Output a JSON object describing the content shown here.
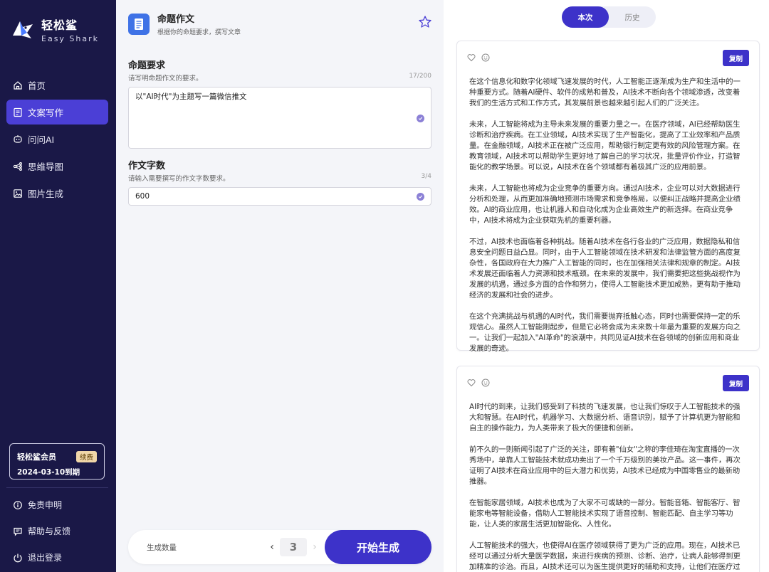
{
  "brand": {
    "name_cn": "轻松鲨",
    "name_en": "Easy Shark"
  },
  "nav": {
    "items": [
      {
        "label": "首页",
        "icon": "home-icon"
      },
      {
        "label": "文案写作",
        "icon": "document-icon",
        "active": true
      },
      {
        "label": "问问AI",
        "icon": "chat-ai-icon"
      },
      {
        "label": "思维导图",
        "icon": "mindmap-icon"
      },
      {
        "label": "图片生成",
        "icon": "image-icon"
      }
    ]
  },
  "member": {
    "title": "轻松鲨会员",
    "renew_label": "续费",
    "expiry": "2024-03-10到期"
  },
  "bottom_nav": {
    "disclaimer": "免责申明",
    "help": "帮助与反馈",
    "logout": "退出登录"
  },
  "tool": {
    "title": "命题作文",
    "subtitle": "根据你的命题要求，撰写文章"
  },
  "requirement": {
    "label": "命题要求",
    "desc": "请写明命题作文的要求。",
    "count": "17/200",
    "value": "以\"AI时代\"为主题写一篇微信推文"
  },
  "wordcount": {
    "label": "作文字数",
    "desc": "请输入需要撰写的作文字数要求。",
    "count": "3/4",
    "value": "600"
  },
  "generate": {
    "count_label": "生成数量",
    "count_value": "3",
    "button_label": "开始生成"
  },
  "result_tabs": {
    "current": "本次",
    "history": "历史"
  },
  "results": [
    {
      "copy_label": "复制",
      "paragraphs": [
        "在这个信息化和数字化领域飞速发展的时代，人工智能正逐渐成为生产和生活中的一种重要方式。随着AI硬件、软件的成熟和普及，AI技术不断向各个领域渗透，改变着我们的生活方式和工作方式，其发展前景也越来越引起人们的广泛关注。",
        "未来，人工智能将成为主导未来发展的重要力量之一。在医疗领域，AI已经帮助医生诊断和治疗疾病。在工业领域，AI技术实现了生产智能化，提高了工业效率和产品质量。在金融领域，AI技术正在被广泛应用，帮助银行制定更有效的风险管理方案。在教育领域，AI技术可以帮助学生更好地了解自己的学习状况，批量评价作业，打造智能化的教学场景。可以说，AI技术在各个领域都有着极其广泛的应用前景。",
        "未来，人工智能也将成为企业竞争的重要方向。通过AI技术，企业可以对大数据进行分析和处理，从而更加准确地预测市场需求和竞争格局，以便纠正战略并提高企业绩效。AI的商业应用，也让机器人和自动化成为企业高效生产的新选择。在商业竞争中，AI技术将成为企业获取先机的重要利器。",
        "不过，AI技术也面临着各种挑战。随着AI技术在各行各业的广泛应用，数据隐私和信息安全问题日益凸显。同时，由于人工智能领域在技术研发和法律监管方面的高度复杂性，各国政府在大力推广人工智能的同时，也在加强相关法律和规章的制定。AI技术发展还面临着人力资源和技术瓶颈。在未来的发展中，我们需要把这些挑战视作为发展的机遇，通过多方面的合作和努力，使得人工智能技术更加成熟，更有助于推动经济的发展和社会的进步。",
        "在这个充满挑战与机遇的AI时代，我们需要抛弃抵触心态，同时也需要保持一定的乐观信心。虽然人工智能刚起步，但是它必将会成为未来数十年最为重要的发展方向之一。让我们一起加入\"AI革命\"的浪潮中，共同见证AI技术在各领域的创新应用和商业发展的奇迹。"
      ]
    },
    {
      "copy_label": "复制",
      "paragraphs": [
        "AI时代的到来，让我们感受到了科技的飞速发展，也让我们惊叹于人工智能技术的强大和智慧。在AI时代，机器学习、大数据分析、语音识别，赋予了计算机更为智能和自主的操作能力，为人类带来了极大的便捷和创新。",
        "前不久的一则新闻引起了广泛的关注，即有着\"仙女\"之称的李佳琦在淘宝直播的一次秀场中，单靠人工智能技术就成功卖出了一个千万级别的美妆产品。这一事件，再次证明了AI技术在商业应用中的巨大潜力和优势，AI技术已经成为中国零售业的最新助推器。",
        "在智能家居领域，AI技术也成为了大家不可或缺的一部分。智能音箱、智能客厅、智能家电等智能设备，借助人工智能技术实现了语音控制、智能匹配、自主学习等功能，让人类的家居生活更加智能化、人性化。",
        "人工智能技术的强大，也使得AI在医疗领域获得了更为广泛的应用。现在，AI技术已经可以通过分析大量医学数据，来进行疾病的预测、诊断、治疗，让病人能够得到更加精准的诊治。而且，AI技术还可以为医生提供更好的辅助和支持，让他们在医疗过程中更加高效、精准、安全。"
      ]
    }
  ],
  "colors": {
    "sidebar_bg": "#1a1847",
    "accent": "#3d32c9",
    "doc_badge": "#3f72e6"
  }
}
